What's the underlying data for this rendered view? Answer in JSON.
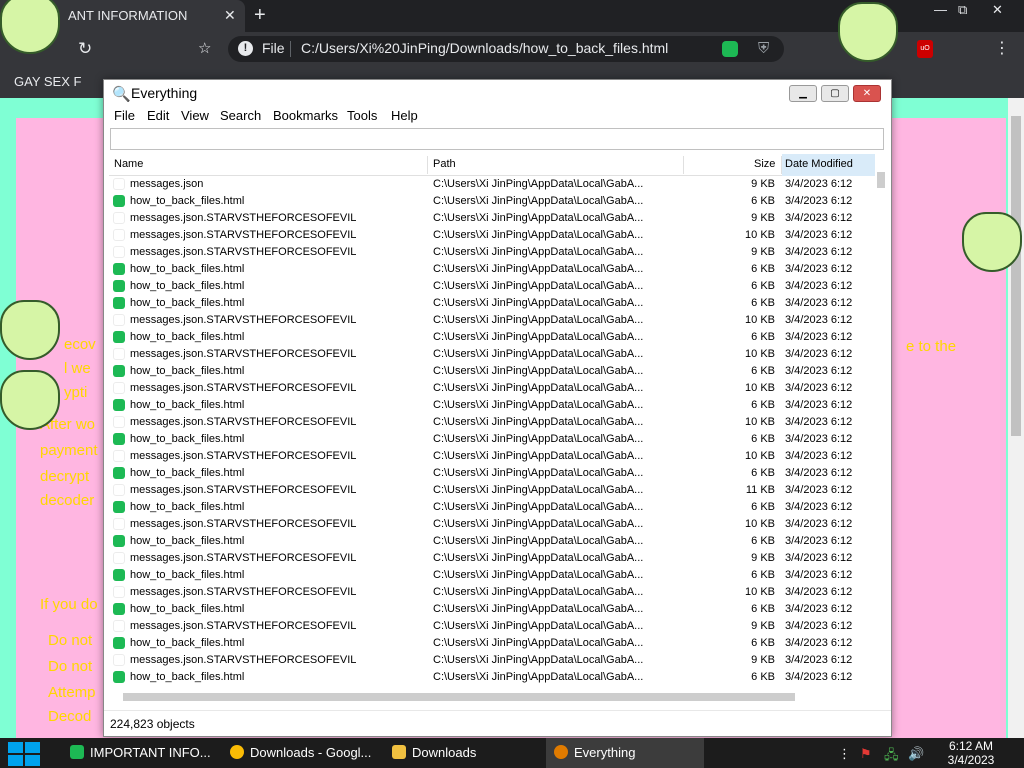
{
  "browser": {
    "tab_title": "ANT INFORMATION",
    "tab_close": "✕",
    "new_tab": "+",
    "window_controls": {
      "minimize": "—",
      "maximize": "⧉",
      "close": "✕"
    },
    "reload": "↻",
    "bookmark_star": "☆",
    "info_icon": "!",
    "omnibox_scheme": "File",
    "url": "C:/Users/Xi%20JinPing/Downloads/how_to_back_files.html",
    "menu_dots": "⋮",
    "bookmark_item": "GAY SEX F"
  },
  "page": {
    "text_lines": [
      "ecov",
      "l we",
      "ypti",
      "After wo",
      "payment",
      "decrypt",
      "decoder",
      "If you do",
      "Do not",
      "Do not",
      "Attemp",
      "Decod",
      "e to the"
    ]
  },
  "everything": {
    "title": "Everything",
    "icon": "search-icon",
    "window_buttons": {
      "minimize": "▁",
      "maximize": "▢",
      "close": "✕"
    },
    "menu": [
      "File",
      "Edit",
      "View",
      "Search",
      "Bookmarks",
      "Tools",
      "Help"
    ],
    "search_value": "",
    "columns": {
      "name": "Name",
      "path": "Path",
      "size": "Size",
      "date": "Date Modified"
    },
    "rows": [
      {
        "icon": "blank",
        "name": "messages.json",
        "path": "C:\\Users\\Xi JinPing\\AppData\\Local\\GabA...",
        "size": "9 KB",
        "date": "3/4/2023 6:12"
      },
      {
        "icon": "green",
        "name": "how_to_back_files.html",
        "path": "C:\\Users\\Xi JinPing\\AppData\\Local\\GabA...",
        "size": "6 KB",
        "date": "3/4/2023 6:12"
      },
      {
        "icon": "blank",
        "name": "messages.json.STARVSTHEFORCESOFEVIL",
        "path": "C:\\Users\\Xi JinPing\\AppData\\Local\\GabA...",
        "size": "9 KB",
        "date": "3/4/2023 6:12"
      },
      {
        "icon": "blank",
        "name": "messages.json.STARVSTHEFORCESOFEVIL",
        "path": "C:\\Users\\Xi JinPing\\AppData\\Local\\GabA...",
        "size": "10 KB",
        "date": "3/4/2023 6:12"
      },
      {
        "icon": "blank",
        "name": "messages.json.STARVSTHEFORCESOFEVIL",
        "path": "C:\\Users\\Xi JinPing\\AppData\\Local\\GabA...",
        "size": "9 KB",
        "date": "3/4/2023 6:12"
      },
      {
        "icon": "green",
        "name": "how_to_back_files.html",
        "path": "C:\\Users\\Xi JinPing\\AppData\\Local\\GabA...",
        "size": "6 KB",
        "date": "3/4/2023 6:12"
      },
      {
        "icon": "green",
        "name": "how_to_back_files.html",
        "path": "C:\\Users\\Xi JinPing\\AppData\\Local\\GabA...",
        "size": "6 KB",
        "date": "3/4/2023 6:12"
      },
      {
        "icon": "green",
        "name": "how_to_back_files.html",
        "path": "C:\\Users\\Xi JinPing\\AppData\\Local\\GabA...",
        "size": "6 KB",
        "date": "3/4/2023 6:12"
      },
      {
        "icon": "blank",
        "name": "messages.json.STARVSTHEFORCESOFEVIL",
        "path": "C:\\Users\\Xi JinPing\\AppData\\Local\\GabA...",
        "size": "10 KB",
        "date": "3/4/2023 6:12"
      },
      {
        "icon": "green",
        "name": "how_to_back_files.html",
        "path": "C:\\Users\\Xi JinPing\\AppData\\Local\\GabA...",
        "size": "6 KB",
        "date": "3/4/2023 6:12"
      },
      {
        "icon": "blank",
        "name": "messages.json.STARVSTHEFORCESOFEVIL",
        "path": "C:\\Users\\Xi JinPing\\AppData\\Local\\GabA...",
        "size": "10 KB",
        "date": "3/4/2023 6:12"
      },
      {
        "icon": "green",
        "name": "how_to_back_files.html",
        "path": "C:\\Users\\Xi JinPing\\AppData\\Local\\GabA...",
        "size": "6 KB",
        "date": "3/4/2023 6:12"
      },
      {
        "icon": "blank",
        "name": "messages.json.STARVSTHEFORCESOFEVIL",
        "path": "C:\\Users\\Xi JinPing\\AppData\\Local\\GabA...",
        "size": "10 KB",
        "date": "3/4/2023 6:12"
      },
      {
        "icon": "green",
        "name": "how_to_back_files.html",
        "path": "C:\\Users\\Xi JinPing\\AppData\\Local\\GabA...",
        "size": "6 KB",
        "date": "3/4/2023 6:12"
      },
      {
        "icon": "blank",
        "name": "messages.json.STARVSTHEFORCESOFEVIL",
        "path": "C:\\Users\\Xi JinPing\\AppData\\Local\\GabA...",
        "size": "10 KB",
        "date": "3/4/2023 6:12"
      },
      {
        "icon": "green",
        "name": "how_to_back_files.html",
        "path": "C:\\Users\\Xi JinPing\\AppData\\Local\\GabA...",
        "size": "6 KB",
        "date": "3/4/2023 6:12"
      },
      {
        "icon": "blank",
        "name": "messages.json.STARVSTHEFORCESOFEVIL",
        "path": "C:\\Users\\Xi JinPing\\AppData\\Local\\GabA...",
        "size": "10 KB",
        "date": "3/4/2023 6:12"
      },
      {
        "icon": "green",
        "name": "how_to_back_files.html",
        "path": "C:\\Users\\Xi JinPing\\AppData\\Local\\GabA...",
        "size": "6 KB",
        "date": "3/4/2023 6:12"
      },
      {
        "icon": "blank",
        "name": "messages.json.STARVSTHEFORCESOFEVIL",
        "path": "C:\\Users\\Xi JinPing\\AppData\\Local\\GabA...",
        "size": "11 KB",
        "date": "3/4/2023 6:12"
      },
      {
        "icon": "green",
        "name": "how_to_back_files.html",
        "path": "C:\\Users\\Xi JinPing\\AppData\\Local\\GabA...",
        "size": "6 KB",
        "date": "3/4/2023 6:12"
      },
      {
        "icon": "blank",
        "name": "messages.json.STARVSTHEFORCESOFEVIL",
        "path": "C:\\Users\\Xi JinPing\\AppData\\Local\\GabA...",
        "size": "10 KB",
        "date": "3/4/2023 6:12"
      },
      {
        "icon": "green",
        "name": "how_to_back_files.html",
        "path": "C:\\Users\\Xi JinPing\\AppData\\Local\\GabA...",
        "size": "6 KB",
        "date": "3/4/2023 6:12"
      },
      {
        "icon": "blank",
        "name": "messages.json.STARVSTHEFORCESOFEVIL",
        "path": "C:\\Users\\Xi JinPing\\AppData\\Local\\GabA...",
        "size": "9 KB",
        "date": "3/4/2023 6:12"
      },
      {
        "icon": "green",
        "name": "how_to_back_files.html",
        "path": "C:\\Users\\Xi JinPing\\AppData\\Local\\GabA...",
        "size": "6 KB",
        "date": "3/4/2023 6:12"
      },
      {
        "icon": "blank",
        "name": "messages.json.STARVSTHEFORCESOFEVIL",
        "path": "C:\\Users\\Xi JinPing\\AppData\\Local\\GabA...",
        "size": "10 KB",
        "date": "3/4/2023 6:12"
      },
      {
        "icon": "green",
        "name": "how_to_back_files.html",
        "path": "C:\\Users\\Xi JinPing\\AppData\\Local\\GabA...",
        "size": "6 KB",
        "date": "3/4/2023 6:12"
      },
      {
        "icon": "blank",
        "name": "messages.json.STARVSTHEFORCESOFEVIL",
        "path": "C:\\Users\\Xi JinPing\\AppData\\Local\\GabA...",
        "size": "9 KB",
        "date": "3/4/2023 6:12"
      },
      {
        "icon": "green",
        "name": "how_to_back_files.html",
        "path": "C:\\Users\\Xi JinPing\\AppData\\Local\\GabA...",
        "size": "6 KB",
        "date": "3/4/2023 6:12"
      },
      {
        "icon": "blank",
        "name": "messages.json.STARVSTHEFORCESOFEVIL",
        "path": "C:\\Users\\Xi JinPing\\AppData\\Local\\GabA...",
        "size": "9 KB",
        "date": "3/4/2023 6:12"
      },
      {
        "icon": "green",
        "name": "how_to_back_files.html",
        "path": "C:\\Users\\Xi JinPing\\AppData\\Local\\GabA...",
        "size": "6 KB",
        "date": "3/4/2023 6:12"
      }
    ],
    "status": "224,823 objects"
  },
  "taskbar": {
    "items": [
      {
        "label": "IMPORTANT INFO...",
        "icon": "green-doc-icon",
        "active": false
      },
      {
        "label": "Downloads - Googl...",
        "icon": "chrome-icon",
        "active": false
      },
      {
        "label": "Downloads",
        "icon": "folder-icon",
        "active": false
      },
      {
        "label": "Everything",
        "icon": "search-icon",
        "active": true
      }
    ],
    "tray": {
      "more": "⋮",
      "flag": "⚑",
      "network": "🖧",
      "volume": "🔊"
    },
    "clock": {
      "time": "6:12 AM",
      "date": "3/4/2023"
    }
  },
  "colors": {
    "page_bg": "#7fffd4",
    "page_inner": "#ffb6e1",
    "page_text": "#ffd700",
    "green_icon": "#1db954",
    "sorted_header": "#d9ebf9"
  }
}
